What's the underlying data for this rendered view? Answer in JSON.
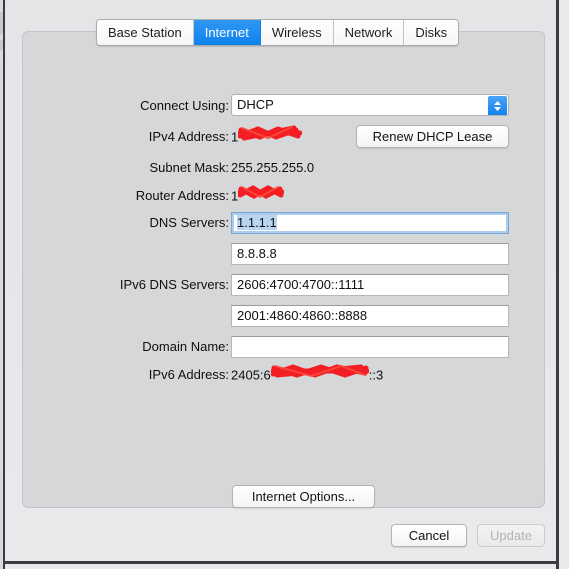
{
  "window": {
    "tabs": [
      {
        "label": "Base Station",
        "selected": false
      },
      {
        "label": "Internet",
        "selected": true
      },
      {
        "label": "Wireless",
        "selected": false
      },
      {
        "label": "Network",
        "selected": false
      },
      {
        "label": "Disks",
        "selected": false
      }
    ]
  },
  "form": {
    "connect_using": {
      "label": "Connect Using:",
      "value": "DHCP"
    },
    "ipv4_address": {
      "label": "IPv4 Address:",
      "value_prefix": "1",
      "value_suffix": "",
      "redacted": true
    },
    "renew_button": {
      "label": "Renew DHCP Lease"
    },
    "subnet_mask": {
      "label": "Subnet Mask:",
      "value": "255.255.255.0"
    },
    "router_address": {
      "label": "Router Address:",
      "value_prefix": "1",
      "value_suffix": "",
      "redacted": true
    },
    "dns_servers": {
      "label": "DNS Servers:",
      "value_1": "1.1.1.1",
      "value_2": "8.8.8.8"
    },
    "ipv6_dns_servers": {
      "label": "IPv6 DNS Servers:",
      "value_1": "2606:4700:4700::1111",
      "value_2": "2001:4860:4860::8888"
    },
    "domain_name": {
      "label": "Domain Name:",
      "value": ""
    },
    "ipv6_address": {
      "label": "IPv6 Address:",
      "value_prefix": "2405:6",
      "value_suffix": "::3",
      "redacted": true
    },
    "internet_options_button": {
      "label": "Internet Options..."
    }
  },
  "footer": {
    "cancel_label": "Cancel",
    "update_label": "Update",
    "update_disabled": true
  },
  "icons": {
    "popup_indicator": "chevron-up-down-icon"
  },
  "colors": {
    "accent_blue": "#1180ee",
    "selected_tab_blue": "#0f82ee",
    "selection_highlight": "#b9d5f2",
    "redaction_red": "#f4151a",
    "panel_bg": "#d6d7d9",
    "window_bg": "#e6e7e9"
  }
}
